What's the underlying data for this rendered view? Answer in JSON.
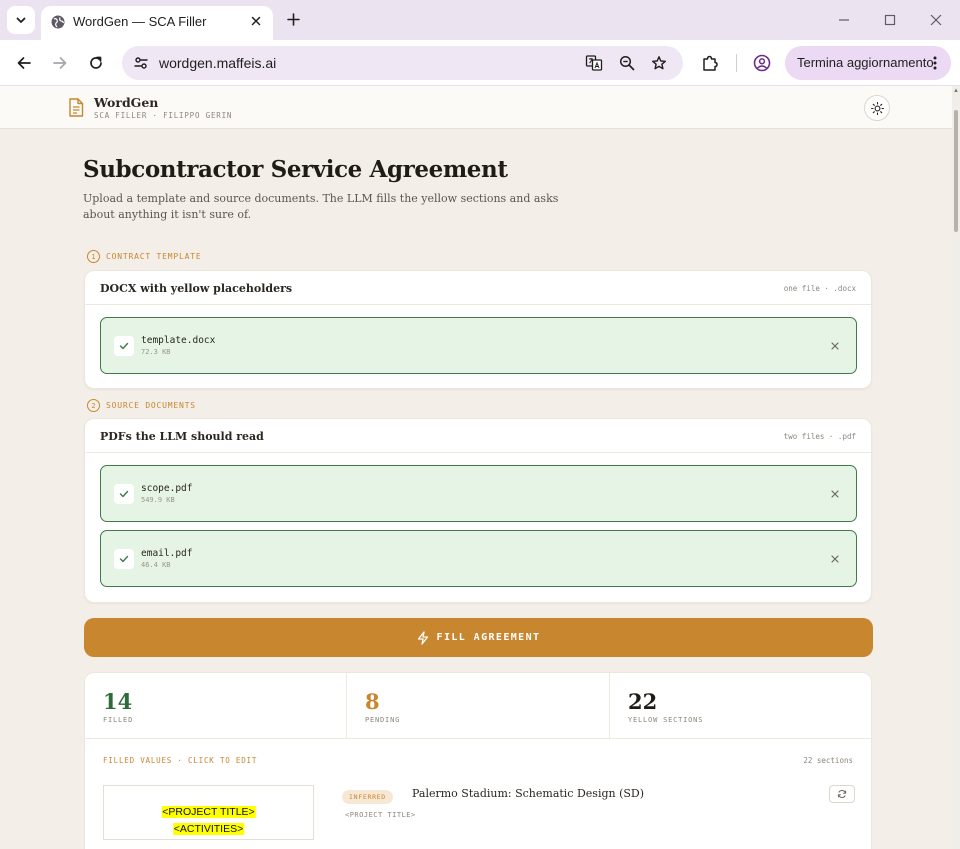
{
  "browser": {
    "tab_title": "WordGen — SCA Filler",
    "url": "wordgen.maffeis.ai",
    "update_label": "Termina aggiornamento"
  },
  "app": {
    "brand": "WordGen",
    "brand_sub": "SCA FILLER · FILIPPO GERIN"
  },
  "page": {
    "title": "Subcontractor Service Agreement",
    "subtitle": "Upload a template and source documents. The LLM fills the yellow sections and asks about anything it isn't sure of."
  },
  "template_section": {
    "step": "1",
    "label": "CONTRACT TEMPLATE",
    "card_title": "DOCX with yellow placeholders",
    "card_meta": "one file · .docx",
    "files": [
      {
        "name": "template.docx",
        "size": "72.3 KB"
      }
    ]
  },
  "source_section": {
    "step": "2",
    "label": "SOURCE DOCUMENTS",
    "card_title": "PDFs the LLM should read",
    "card_meta": "two files · .pdf",
    "files": [
      {
        "name": "scope.pdf",
        "size": "549.9 KB"
      },
      {
        "name": "email.pdf",
        "size": "46.4 KB"
      }
    ]
  },
  "fill_button": {
    "label": "FILL AGREEMENT"
  },
  "stats": [
    {
      "value": "14",
      "label": "FILLED",
      "color": "#2f6b3a"
    },
    {
      "value": "8",
      "label": "PENDING",
      "color": "#c8862f"
    },
    {
      "value": "22",
      "label": "YELLOW SECTIONS",
      "color": "#1f1c18"
    }
  ],
  "filled_values": {
    "heading": "FILLED VALUES · CLICK TO EDIT",
    "count": "22 sections",
    "items": [
      {
        "preview_lines": [
          "<PROJECT TITLE>",
          "<ACTIVITIES>"
        ],
        "tag": "INFERRED",
        "value": "Palermo Stadium: Schematic Design (SD)",
        "key": "<PROJECT TITLE>"
      }
    ]
  },
  "colors": {
    "accent": "#c8862f",
    "success_bg": "#e6f4e5",
    "success_border": "#3f7a48",
    "page_bg": "#f3efe8"
  }
}
